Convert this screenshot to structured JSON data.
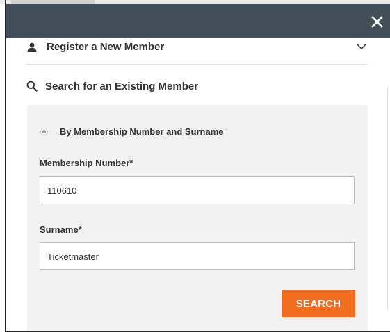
{
  "colors": {
    "header_bg": "#424f5a",
    "panel_bg": "#f2f2f2",
    "accent": "#f26d1f",
    "text": "#333333",
    "close_icon": "#ffffff"
  },
  "modal": {
    "close_icon": "close-icon"
  },
  "register": {
    "icon": "user-icon",
    "label": "Register a New Member",
    "expand_icon": "chevron-down-icon"
  },
  "search_section": {
    "icon": "search-icon",
    "label": "Search for an Existing Member"
  },
  "search_form": {
    "radio_label": "By Membership Number and Surname",
    "radio_selected": true,
    "membership_label": "Membership Number*",
    "membership_value": "110610",
    "surname_label": "Surname*",
    "surname_value": "Ticketmaster",
    "search_button": "SEARCH"
  }
}
